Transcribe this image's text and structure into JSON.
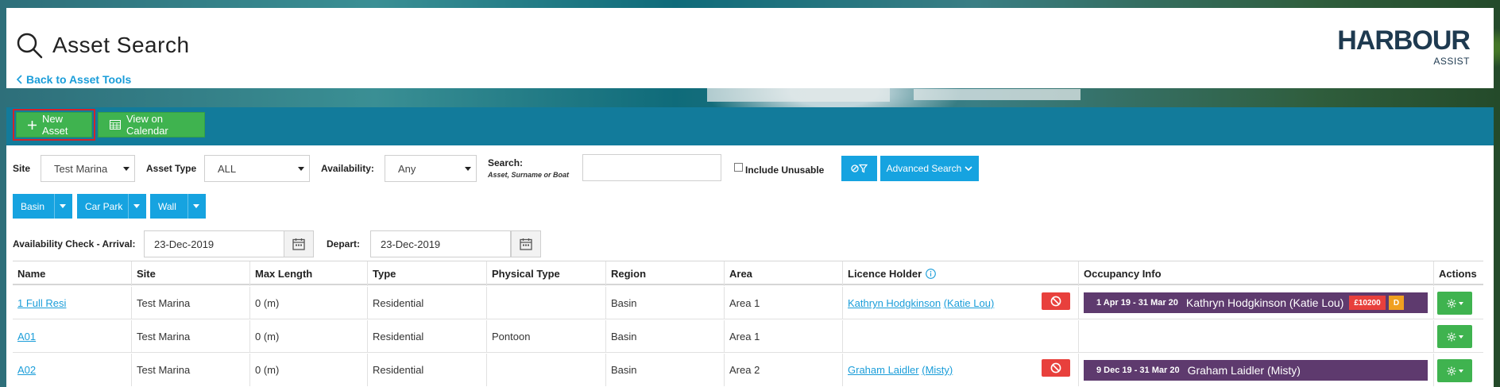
{
  "header": {
    "title": "Asset Search",
    "back_link": "Back to Asset Tools",
    "logo_main": "HARBOUR",
    "logo_sub": "ASSIST"
  },
  "toolbar": {
    "new_asset": "New Asset",
    "view_calendar": "View on Calendar"
  },
  "filters": {
    "site_label": "Site",
    "site_value": "Test Marina",
    "asset_type_label": "Asset Type",
    "asset_type_value": "ALL",
    "availability_label": "Availability:",
    "availability_value": "Any",
    "search_label": "Search:",
    "search_sub": "Asset, Surname or Boat",
    "search_value": "",
    "include_unusable": "Include Unusable",
    "advanced_search": "Advanced Search"
  },
  "groups": [
    "Basin",
    "Car Park",
    "Wall"
  ],
  "availability_check": {
    "arrival_label": "Availability Check - Arrival:",
    "arrival_value": "23-Dec-2019",
    "depart_label": "Depart:",
    "depart_value": "23-Dec-2019"
  },
  "table": {
    "columns": [
      "Name",
      "Site",
      "Max Length",
      "Type",
      "Physical Type",
      "Region",
      "Area",
      "Licence Holder",
      "Occupancy Info",
      "Actions"
    ],
    "rows": [
      {
        "name": "1 Full Resi",
        "site": "Test Marina",
        "max_length": "0 (m)",
        "type": "Residential",
        "physical_type": "",
        "region": "Basin",
        "area": "Area 1",
        "holder": "Kathryn Hodgkinson",
        "boat": "(Katie Lou)",
        "occ_dates": "1 Apr 19 - 31 Mar 20",
        "occ_who": "Kathryn Hodgkinson (Katie Lou)",
        "badge_amount": "£10200",
        "badge_d": "D"
      },
      {
        "name": "A01",
        "site": "Test Marina",
        "max_length": "0 (m)",
        "type": "Residential",
        "physical_type": "Pontoon",
        "region": "Basin",
        "area": "Area 1",
        "holder": "",
        "boat": "",
        "occ_dates": "",
        "occ_who": ""
      },
      {
        "name": "A02",
        "site": "Test Marina",
        "max_length": "0 (m)",
        "type": "Residential",
        "physical_type": "",
        "region": "Basin",
        "area": "Area 2",
        "holder": "Graham Laidler",
        "boat": "(Misty)",
        "occ_dates": "9 Dec 19 - 31 Mar 20",
        "occ_who": "Graham Laidler (Misty)"
      }
    ]
  },
  "colors": {
    "toolbar": "#127b9b",
    "green": "#3fb34f",
    "blue": "#16a3e0",
    "occupancy": "#5e3a6e",
    "danger": "#e8403c",
    "badge_amount": "#e8403c",
    "badge_d": "#f0a020"
  }
}
